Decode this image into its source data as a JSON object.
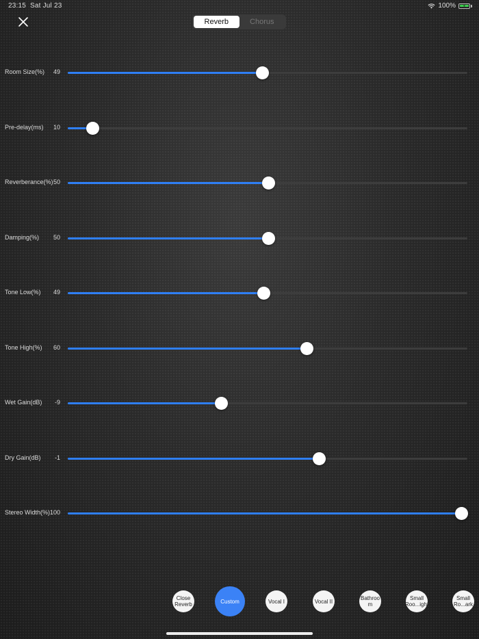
{
  "status": {
    "time": "23:15",
    "date": "Sat Jul 23",
    "battery": "100%"
  },
  "tabs": [
    {
      "label": "Reverb",
      "active": true
    },
    {
      "label": "Chorus",
      "active": false
    }
  ],
  "sliders": [
    {
      "label": "Room Size(%)",
      "value": "49",
      "fraction": 0.488
    },
    {
      "label": "Pre-delay(ms)",
      "value": "10",
      "fraction": 0.063
    },
    {
      "label": "Reverberance(%)",
      "value": "50",
      "fraction": 0.502
    },
    {
      "label": "Damping(%)",
      "value": "50",
      "fraction": 0.502
    },
    {
      "label": "Tone Low(%)",
      "value": "49",
      "fraction": 0.491
    },
    {
      "label": "Tone High(%)",
      "value": "60",
      "fraction": 0.598
    },
    {
      "label": "Wet Gain(dB)",
      "value": "-9",
      "fraction": 0.384
    },
    {
      "label": "Dry Gain(dB)",
      "value": "-1",
      "fraction": 0.63
    },
    {
      "label": "Stereo Width(%)",
      "value": "100",
      "fraction": 0.986
    }
  ],
  "presets": [
    {
      "label": "Close Reverb",
      "active": false
    },
    {
      "label": "Custom",
      "active": true
    },
    {
      "label": "Vocal I",
      "active": false
    },
    {
      "label": "Vocal II",
      "active": false
    },
    {
      "label": "Bathroo m",
      "active": false
    },
    {
      "label": "Small Roo...ight",
      "active": false
    },
    {
      "label": "Small Ro...ark",
      "active": false
    }
  ],
  "colors": {
    "accent": "#2f7ff5",
    "preset_active": "#3b82f6"
  }
}
